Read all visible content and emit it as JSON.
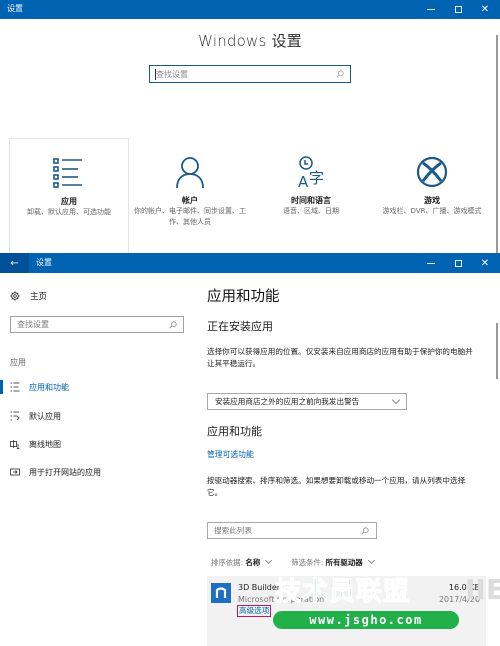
{
  "home_window": {
    "title": "设置",
    "heading": "Windows 设置",
    "search_placeholder": "查找设置",
    "tiles": [
      {
        "name": "应用",
        "desc": "卸载、默认应用、可选功能",
        "icon": "apps-list-icon"
      },
      {
        "name": "帐户",
        "desc": "你的帐户、电子邮件、同步设置、工作、其他人员",
        "icon": "account-person-icon"
      },
      {
        "name": "时间和语言",
        "desc": "语音、区域、日期",
        "icon": "time-language-icon"
      },
      {
        "name": "游戏",
        "desc": "游戏栏、DVR、广播、游戏模式",
        "icon": "xbox-icon"
      }
    ]
  },
  "apps_window": {
    "title": "设置",
    "sidebar": {
      "home_label": "主页",
      "search_placeholder": "查找设置",
      "section_label": "应用",
      "items": [
        {
          "label": "应用和功能",
          "icon": "apps-features-icon",
          "active": true
        },
        {
          "label": "默认应用",
          "icon": "default-apps-icon",
          "active": false
        },
        {
          "label": "离线地图",
          "icon": "offline-maps-icon",
          "active": false
        },
        {
          "label": "用于打开网站的应用",
          "icon": "apps-for-websites-icon",
          "active": false
        }
      ]
    },
    "content": {
      "page_title": "应用和功能",
      "installing_heading": "正在安装应用",
      "installing_desc": "选择你可以获得应用的位置。仅安装来自应用商店的应用有助于保护你的电脑并让其平稳运行。",
      "install_dropdown_value": "安装应用商店之外的应用之前向我发出警告",
      "apps_heading": "应用和功能",
      "manage_link": "管理可选功能",
      "apps_desc": "按驱动器搜索、排序和筛选。如果想要卸载或移动一个应用，请从列表中选择它。",
      "list_search_placeholder": "搜索此列表",
      "sort_label": "排序依据:",
      "sort_value": "名称",
      "filter_label": "筛选条件:",
      "filter_value": "所有驱动器",
      "apps": [
        {
          "name": "3D Builder",
          "publisher": "Microsoft Corporation",
          "size": "16.0 KB",
          "date": "2017/4/20",
          "advanced_link": "高级选项"
        }
      ]
    }
  },
  "watermark": {
    "main": "技术员联盟",
    "url": "www.jsgho.com"
  },
  "colors": {
    "accent": "#0063b1",
    "titlebar": "#0063b1",
    "highlight_box": "#c2185b",
    "watermark_green": "#22b04b"
  }
}
